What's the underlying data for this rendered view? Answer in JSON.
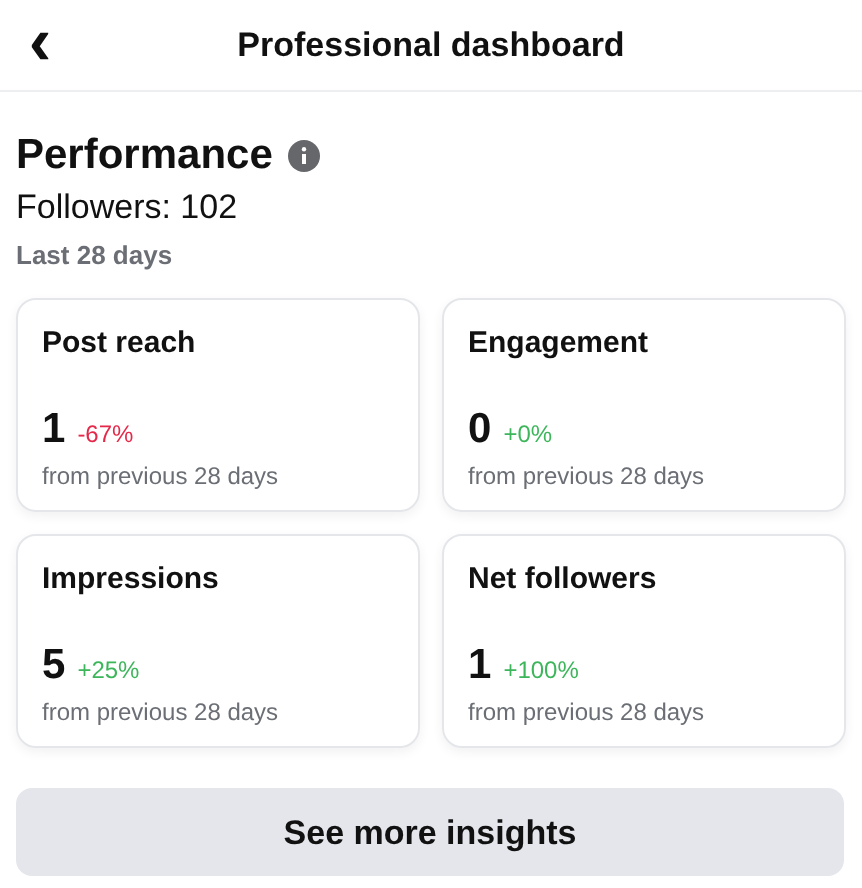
{
  "header": {
    "back": "‹",
    "title": "Professional dashboard"
  },
  "performance": {
    "title": "Performance",
    "followers": "Followers: 102",
    "period": "Last 28 days"
  },
  "metrics": [
    {
      "label": "Post reach",
      "value": "1",
      "change": "-67%",
      "color": "#e4294a",
      "note": "from previous 28 days"
    },
    {
      "label": "Engagement",
      "value": "0",
      "change": "+0%",
      "color": "#3db65b",
      "note": "from previous 28 days"
    },
    {
      "label": "Impressions",
      "value": "5",
      "change": "+25%",
      "color": "#3db65b",
      "note": "from previous 28 days"
    },
    {
      "label": "Net followers",
      "value": "1",
      "change": "+100%",
      "color": "#3db65b",
      "note": "from previous 28 days"
    }
  ],
  "button": "See more insights"
}
